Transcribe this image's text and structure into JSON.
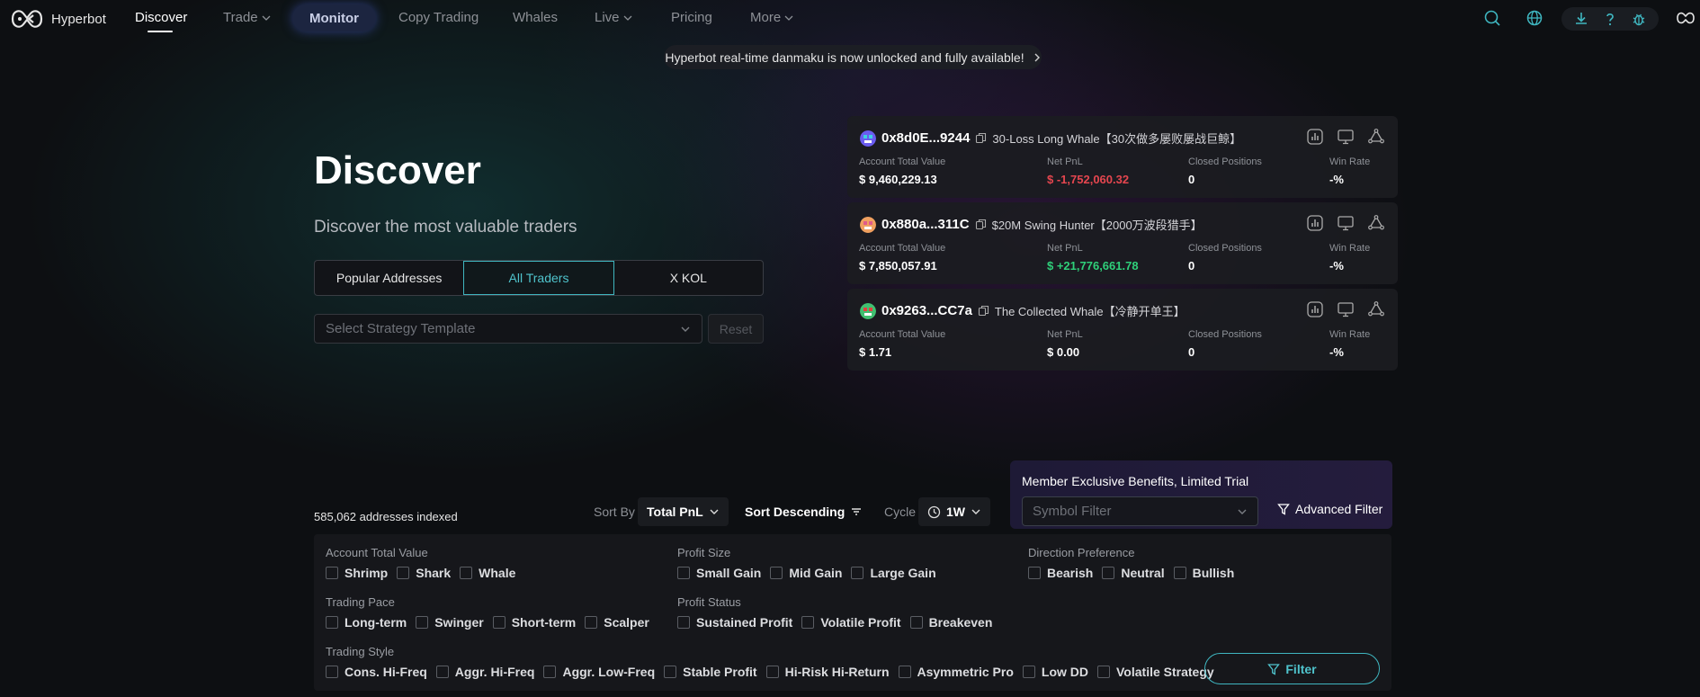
{
  "nav": {
    "brand": "Hyperbot",
    "items": [
      {
        "label": "Discover",
        "active": true
      },
      {
        "label": "Trade",
        "dropdown": true
      },
      {
        "label": "Monitor",
        "highlight": true
      },
      {
        "label": "Copy Trading"
      },
      {
        "label": "Whales"
      },
      {
        "label": "Live",
        "dropdown": true
      },
      {
        "label": "Pricing"
      },
      {
        "label": "More",
        "dropdown": true
      }
    ],
    "icons": [
      "search-icon",
      "globe-icon",
      "download-icon",
      "help-icon",
      "bug-icon",
      "gamepad-icon"
    ]
  },
  "banner": {
    "text": "Hyperbot real-time danmaku is now unlocked and fully available!"
  },
  "hero": {
    "title": "Discover",
    "subtitle": "Discover the most valuable traders",
    "tabs": [
      {
        "label": "Popular Addresses"
      },
      {
        "label": "All Traders",
        "active": true
      },
      {
        "label": "X KOL"
      }
    ],
    "strategy_placeholder": "Select Strategy Template",
    "reset_label": "Reset"
  },
  "trader_cards": [
    {
      "address": "0x8d0E...9244",
      "tag": "30-Loss Long Whale【30次做多屡败屡战巨鲸】",
      "labels": [
        "Account Total Value",
        "Net PnL",
        "Closed Positions",
        "Win Rate"
      ],
      "values": [
        "$ 9,460,229.13",
        "$ -1,752,060.32",
        "0",
        "-%"
      ],
      "pnl_sign": "neg",
      "avatar_colors": [
        "#6a5cf0",
        "#3fd0e0"
      ]
    },
    {
      "address": "0x880a...311C",
      "tag": "$20M Swing Hunter【2000万波段猎手】",
      "labels": [
        "Account Total Value",
        "Net PnL",
        "Closed Positions",
        "Win Rate"
      ],
      "values": [
        "$ 7,850,057.91",
        "$ +21,776,661.78",
        "0",
        "-%"
      ],
      "pnl_sign": "pos",
      "avatar_colors": [
        "#f0a060",
        "#e05a8a"
      ]
    },
    {
      "address": "0x9263...CC7a",
      "tag": "The Collected Whale【冷静开单王】",
      "labels": [
        "Account Total Value",
        "Net PnL",
        "Closed Positions",
        "Win Rate"
      ],
      "values": [
        "$ 1.71",
        "$ 0.00",
        "0",
        "-%"
      ],
      "pnl_sign": "none",
      "avatar_colors": [
        "#40c070",
        "#e04040"
      ]
    }
  ],
  "toolbar": {
    "indexed": "585,062 addresses indexed",
    "sort_by_label": "Sort By",
    "sort_by_value": "Total PnL",
    "sort_order": "Sort Descending",
    "cycle_label": "Cycle",
    "cycle_value": "1W"
  },
  "member": {
    "title": "Member Exclusive Benefits, Limited Trial",
    "symbol_placeholder": "Symbol Filter",
    "advanced_label": "Advanced Filter"
  },
  "filters": {
    "account_value": {
      "title": "Account Total Value",
      "options": [
        "Shrimp",
        "Shark",
        "Whale"
      ]
    },
    "profit_size": {
      "title": "Profit Size",
      "options": [
        "Small Gain",
        "Mid Gain",
        "Large Gain"
      ]
    },
    "direction": {
      "title": "Direction Preference",
      "options": [
        "Bearish",
        "Neutral",
        "Bullish"
      ]
    },
    "pace": {
      "title": "Trading Pace",
      "options": [
        "Long-term",
        "Swinger",
        "Short-term",
        "Scalper"
      ]
    },
    "profit_status": {
      "title": "Profit Status",
      "options": [
        "Sustained Profit",
        "Volatile Profit",
        "Breakeven"
      ]
    },
    "style": {
      "title": "Trading Style",
      "options": [
        "Cons. Hi-Freq",
        "Aggr. Hi-Freq",
        "Aggr. Low-Freq",
        "Stable Profit",
        "Hi-Risk Hi-Return",
        "Asymmetric Pro",
        "Low DD",
        "Volatile Strategy"
      ]
    },
    "filter_button": "Filter"
  },
  "colors": {
    "accent": "#3fb6c0",
    "negative": "#e5464f",
    "positive": "#2fd07a"
  }
}
